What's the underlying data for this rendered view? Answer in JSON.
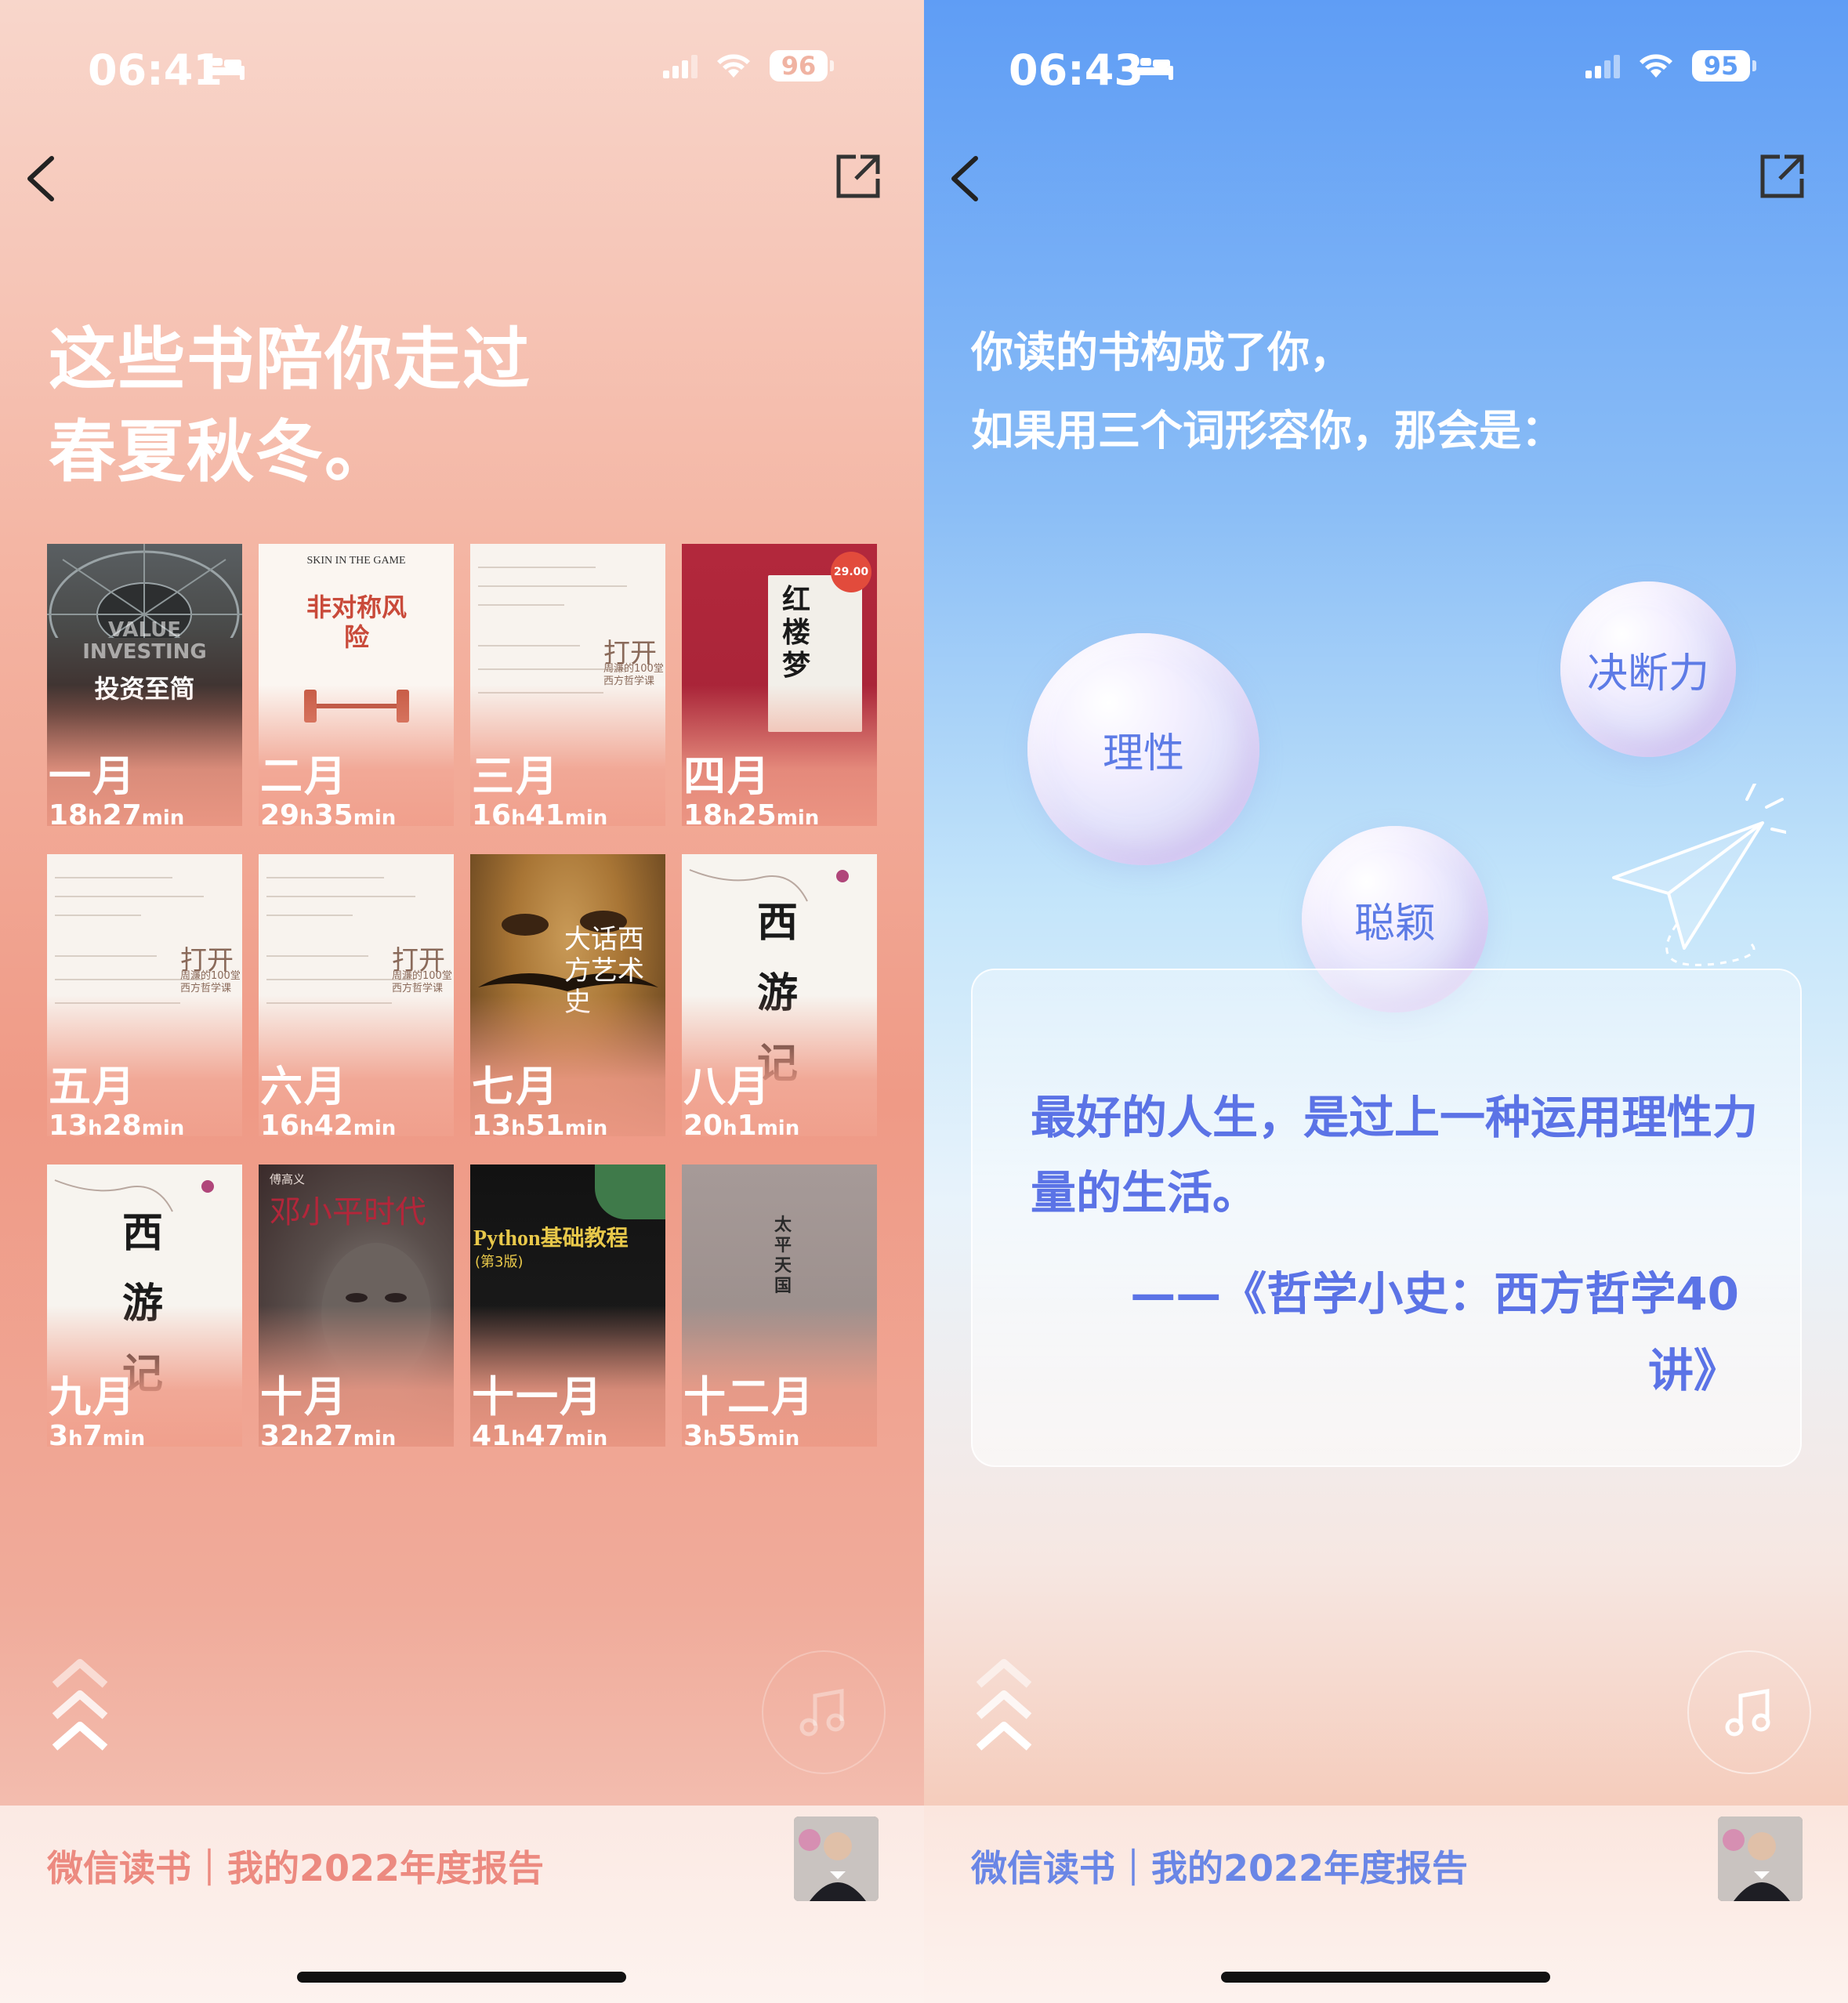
{
  "left": {
    "status": {
      "time": "06:41",
      "battery": "96"
    },
    "headline": [
      "这些书陪你走过",
      "春夏秋冬。"
    ],
    "books": [
      {
        "month": "一月",
        "h": "18",
        "m": "27",
        "cover_title": "投资至简",
        "cover_sub": "VALUE INVESTING"
      },
      {
        "month": "二月",
        "h": "29",
        "m": "35",
        "cover_title": "非对称风险",
        "cover_sub": "SKIN IN THE GAME"
      },
      {
        "month": "三月",
        "h": "16",
        "m": "41",
        "cover_title": "打开",
        "cover_sub": "周濂的100堂西方哲学课"
      },
      {
        "month": "四月",
        "h": "18",
        "m": "25",
        "cover_title": "红楼梦",
        "cover_sub": "29.00"
      },
      {
        "month": "五月",
        "h": "13",
        "m": "28",
        "cover_title": "打开",
        "cover_sub": "周濂的100堂西方哲学课"
      },
      {
        "month": "六月",
        "h": "16",
        "m": "42",
        "cover_title": "打开",
        "cover_sub": "周濂的100堂西方哲学课"
      },
      {
        "month": "七月",
        "h": "13",
        "m": "51",
        "cover_title": "大话西方艺术史",
        "cover_sub": ""
      },
      {
        "month": "八月",
        "h": "20",
        "m": "1",
        "cover_title": "西游记",
        "cover_sub": ""
      },
      {
        "month": "九月",
        "h": "3",
        "m": "7",
        "cover_title": "西游记",
        "cover_sub": ""
      },
      {
        "month": "十月",
        "h": "32",
        "m": "27",
        "cover_title": "邓小平时代",
        "cover_sub": "傅高义"
      },
      {
        "month": "十一月",
        "h": "41",
        "m": "47",
        "cover_title": "Python基础教程",
        "cover_sub": "(第3版)"
      },
      {
        "month": "十二月",
        "h": "3",
        "m": "55",
        "cover_title": "太平天国",
        "cover_sub": ""
      }
    ],
    "unit_h": "h",
    "unit_min": "min",
    "footer": "微信读书｜我的2022年度报告"
  },
  "right": {
    "status": {
      "time": "06:43",
      "battery": "95"
    },
    "question": [
      "你读的书构成了你，",
      "如果用三个词形容你，那会是："
    ],
    "bubbles": [
      "理性",
      "决断力",
      "聪颖"
    ],
    "quote": "最好的人生，是过上一种运用理性力量的生活。",
    "source": "——《哲学小史：西方哲学40讲》",
    "footer": "微信读书｜我的2022年度报告"
  },
  "colors": {
    "left_footer_text": "#ec8a80",
    "right_footer_text": "#6a86e6",
    "quote_text": "#5b73e6"
  },
  "icons": [
    "back-chevron-icon",
    "share-icon",
    "bed-icon",
    "signal-icon",
    "wifi-icon",
    "battery-icon",
    "scroll-up-icon",
    "music-note-icon"
  ]
}
